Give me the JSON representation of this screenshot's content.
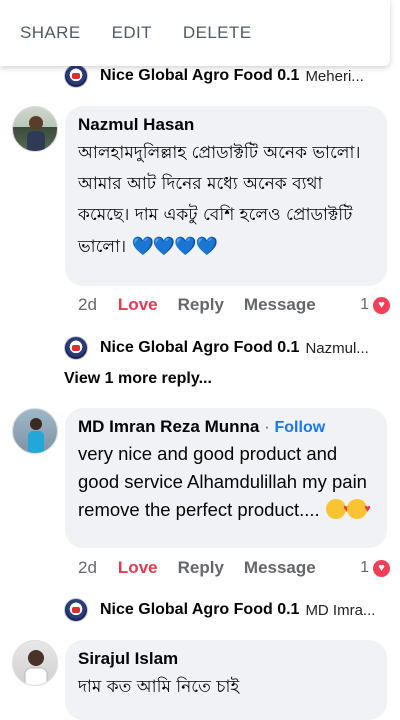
{
  "context_menu": {
    "share": "SHARE",
    "edit": "EDIT",
    "delete": "DELETE"
  },
  "replies": [
    {
      "name": "Nice Global Agro Food 0.1",
      "preview": "Meheri..."
    },
    {
      "name": "Nice Global Agro Food 0.1",
      "preview": "Nazmul..."
    },
    {
      "name": "Nice Global Agro Food 0.1",
      "preview": "MD Imra..."
    }
  ],
  "comments": [
    {
      "name": "Nazmul Hasan",
      "text": "আলহামদুলিল্লাহ প্রোডাক্টটি অনেক ভালো। আমার  আট দিনের মধ্যে অনেক ব্যথা কমেছে। দাম একটু বেশি হলেও প্রোডাক্টটি ভালো। ",
      "emoji": "💙💙💙💙",
      "time": "2d",
      "love": "Love",
      "reply": "Reply",
      "message": "Message",
      "reaction_count": "1"
    },
    {
      "name": "MD Imran Reza Munna",
      "separator": "·",
      "follow": "Follow",
      "text": "very nice and good product and good service Alhamdulillah  my pain remove the perfect product.... ",
      "time": "2d",
      "love": "Love",
      "reply": "Reply",
      "message": "Message",
      "reaction_count": "1"
    },
    {
      "name": "Sirajul Islam",
      "text": "দাম কত আমি  নিতে চাই"
    }
  ],
  "view_more": "View 1 more reply...",
  "colors": {
    "love": "#e63a4f",
    "follow": "#1877f2",
    "bubble": "#f0f2f5",
    "heart_reaction": "#f33e58"
  },
  "icons": {
    "reaction": "heart-reaction-icon",
    "page_avatar": "page-logo-icon"
  }
}
